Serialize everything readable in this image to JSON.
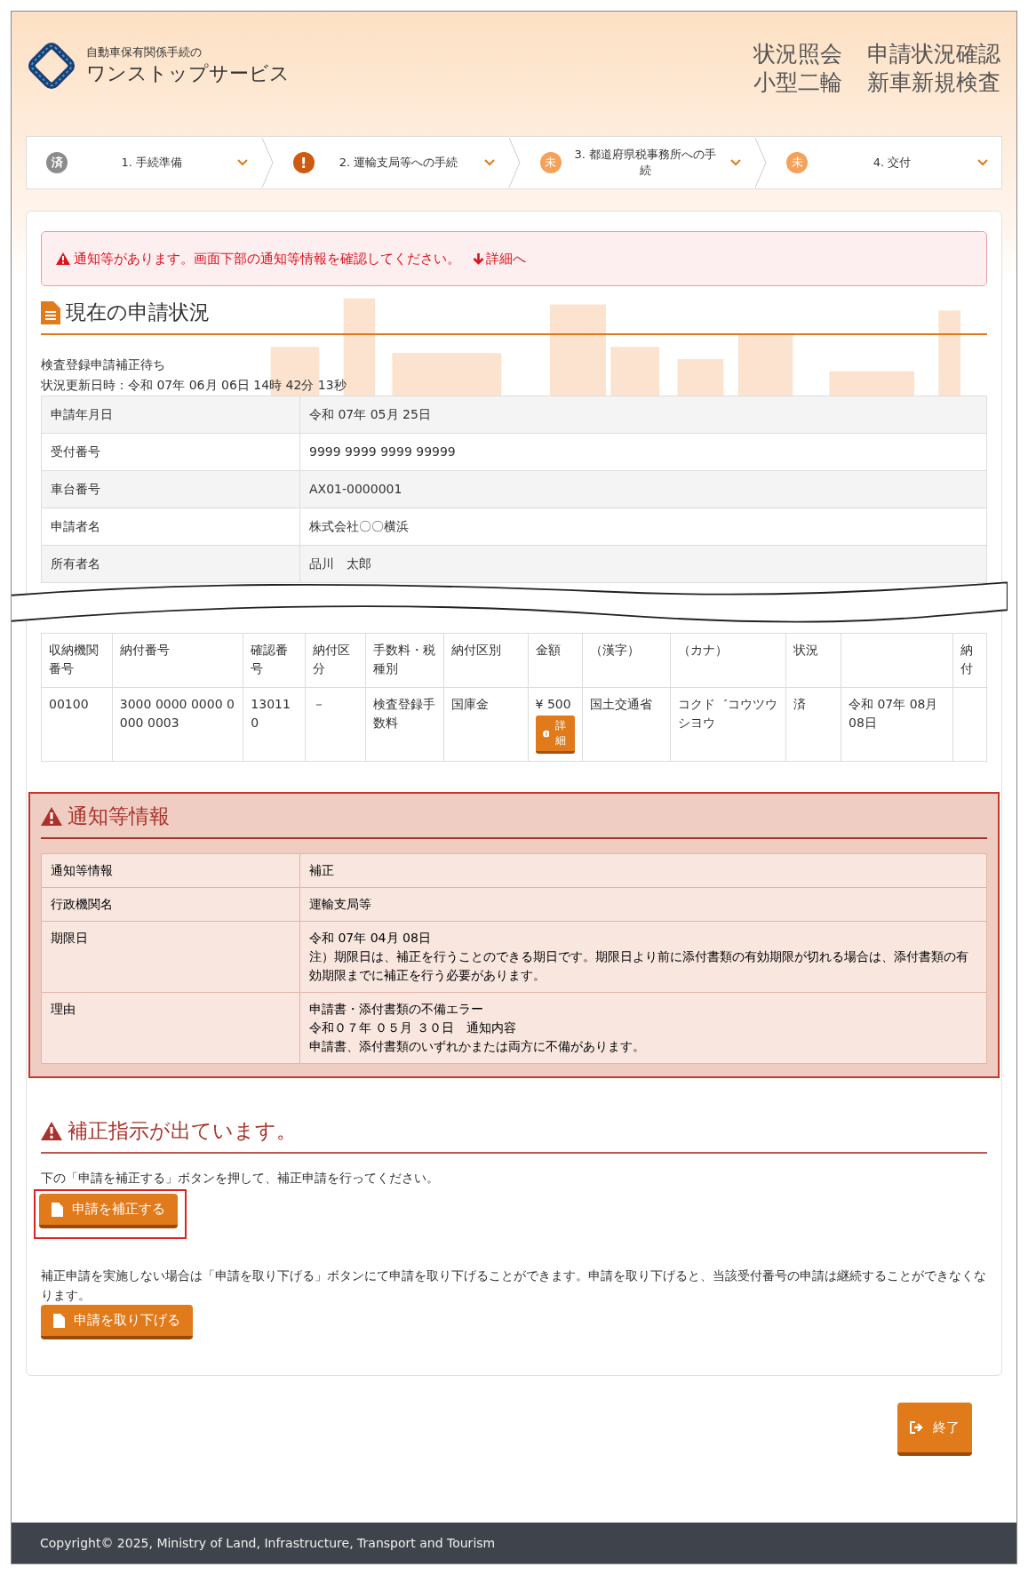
{
  "header": {
    "logo_caption": "自動車保有関係手続の",
    "logo_title": "ワンストップサービス",
    "titles": [
      [
        "状況照会",
        "申請状況確認"
      ],
      [
        "小型二輪",
        "新車新規検査"
      ]
    ]
  },
  "steps": [
    {
      "kind": "done",
      "badge": "済",
      "label": "1. 手続準備"
    },
    {
      "kind": "alert",
      "badge": "!",
      "label": "2. 運輸支局等への手続"
    },
    {
      "kind": "pending",
      "badge": "未",
      "label": "3. 都道府県税事務所への手続"
    },
    {
      "kind": "pending",
      "badge": "未",
      "label": "4. 交付"
    }
  ],
  "alert": {
    "text": "通知等があります。画面下部の通知等情報を確認してください。",
    "link": "詳細へ"
  },
  "status_section": {
    "title": "現在の申請状況",
    "status": "検査登録申請補正待ち",
    "updated": "状況更新日時：令和 07年 06月 06日 14時 42分 13秒",
    "rows": [
      {
        "label": "申請年月日",
        "value": "令和 07年 05月 25日"
      },
      {
        "label": "受付番号",
        "value": "9999 9999 9999 99999"
      },
      {
        "label": "車台番号",
        "value": "AX01-0000001"
      },
      {
        "label": "申請者名",
        "value": "株式会社〇〇横浜"
      },
      {
        "label": "所有者名",
        "value": "品川　太郎"
      }
    ]
  },
  "payment_table": {
    "columns": [
      "収納機関番号",
      "納付番号",
      "確認番号",
      "納付区分",
      "手数料・税種別",
      "納付区別",
      "金額",
      "（漢字）",
      "（カナ）",
      "状況",
      null,
      "納付"
    ],
    "rows": [
      {
        "cells": [
          "00100",
          "3000 0000 0000 0000 0003",
          "130110",
          "－",
          "検査登録手数料",
          "国庫金",
          "¥ 500",
          "国土交通省",
          "コクド゛コウツウシヨウ",
          "済",
          "令和 07年 08月 08日",
          ""
        ],
        "detail_button": "詳細"
      }
    ]
  },
  "notice_section": {
    "title": "通知等情報",
    "rows": [
      {
        "label": "通知等情報",
        "lines": [
          "補正"
        ]
      },
      {
        "label": "行政機関名",
        "lines": [
          "運輸支局等"
        ]
      },
      {
        "label": "期限日",
        "lines": [
          "令和 07年 04月 08日",
          "注）期限日は、補正を行うことのできる期日です。期限日より前に添付書類の有効期限が切れる場合は、添付書類の有効期限までに補正を行う必要があります。"
        ]
      },
      {
        "label": "理由",
        "lines": [
          "申請書・添付書類の不備エラー",
          "令和０７年 ０５月 ３０日　通知内容",
          "申請書、添付書類のいずれかまたは両方に不備があります。"
        ]
      }
    ]
  },
  "correction_section": {
    "title": "補正指示が出ています。",
    "instruction": "下の「申請を補正する」ボタンを押して、補正申請を行ってください。",
    "correct_button": "申請を補正する",
    "withdraw_note": "補正申請を実施しない場合は「申請を取り下げる」ボタンにて申請を取り下げることができます。申請を取り下げると、当該受付番号の申請は継続することができなくなります。",
    "withdraw_button": "申請を取り下げる"
  },
  "exit_button": "終了",
  "footer": "Copyright© 2025, Ministry of Land, Infrastructure, Transport and Tourism"
}
